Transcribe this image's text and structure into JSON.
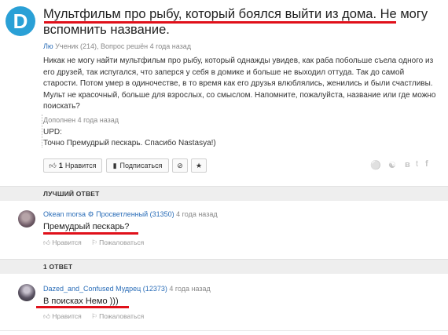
{
  "question": {
    "avatar_letter": "D",
    "title": "Мультфильм про рыбу, который боялся выйти из дома. Не могу вспомнить название.",
    "author": "Лю",
    "author_meta": "Ученик (214), Вопрос решён 4 года назад",
    "body": "Никак не могу найти мультфильм про рыбу, который однажды увидев, как раба побольше съела одного из его друзей, так испугался, что заперся у себя в домике и больше не выходил оттуда. Так до самой старости. Потом умер в одиночестве, в то время как его друзья влюблялись, женились и были счастливы. Мульт не красочный, больше для взрослых, со смыслом. Напомните, пожалуйста, название или где можно поискать?",
    "added_meta": "Дополнен 4 года назад",
    "added_line1": "UPD:",
    "added_line2": "Точно Премудрый пескарь. Спасибо Nastasya!)"
  },
  "actions": {
    "like_count": "1",
    "like_label": "Нравится",
    "subscribe_label": "Подписаться",
    "block_icon": "⊘",
    "star_icon": "★"
  },
  "social": [
    "ok-icon",
    "odnoklassniki-icon",
    "vk-icon",
    "twitter-icon",
    "facebook-icon"
  ],
  "best_section": {
    "label": "ЛУЧШИЙ ОТВЕТ"
  },
  "best_answer": {
    "user": "Okean morsa",
    "rank": "Просветленный (31350)",
    "time": "4 года назад",
    "text": "Премудрый пескарь?",
    "like_label": "Нравится",
    "report_label": "Пожаловаться"
  },
  "answers_section": {
    "label": "1 ОТВЕТ"
  },
  "answer": {
    "user": "Dazed_and_Confused",
    "rank": "Мудрец (12373)",
    "time": "4 года назад",
    "text": "В поисках Немо )))",
    "like_label": "Нравится",
    "report_label": "Пожаловаться"
  },
  "colors": {
    "accent": "#2aa0d6",
    "link": "#2a6db8",
    "underline": "#e0101a"
  }
}
